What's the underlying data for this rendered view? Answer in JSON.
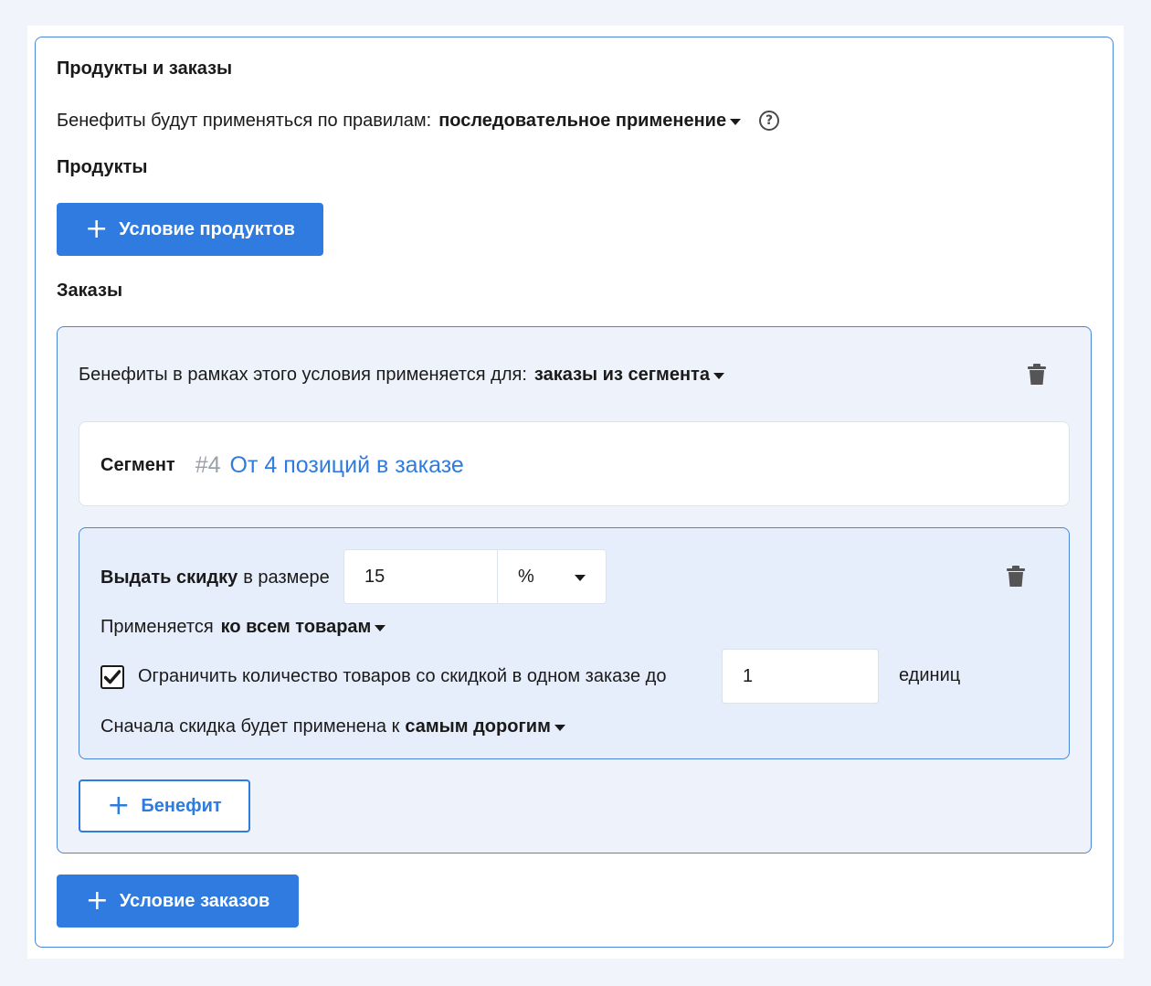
{
  "section": {
    "title": "Продукты и заказы",
    "rules_prefix": "Бенефиты будут применяться по правилам:",
    "rules_value": "последовательное применение"
  },
  "products": {
    "title": "Продукты",
    "add_button": "Условие продуктов"
  },
  "orders": {
    "title": "Заказы",
    "condition": {
      "prefix": "Бенефиты в рамках этого условия применяется для:",
      "value": "заказы из сегмента",
      "segment_label": "Сегмент",
      "segment_id": "#4",
      "segment_name": "От 4 позиций в заказе",
      "benefit": {
        "label_bold": "Выдать скидку",
        "label_rest": "в размере",
        "amount": "15",
        "unit": "%",
        "applies_prefix": "Применяется",
        "applies_value": "ко всем товарам",
        "limit_checked": true,
        "limit_text": "Ограничить количество товаров со скидкой в одном заказе до",
        "limit_value": "1",
        "limit_unit": "единиц",
        "order_prefix": "Сначала скидка будет применена к",
        "order_value": "самым дорогим"
      },
      "add_benefit_button": "Бенефит"
    },
    "add_button": "Условие заказов"
  },
  "colors": {
    "accent": "#2f7be0",
    "panel_border": "#4a86d8",
    "panel_bg": "#eef3fb"
  },
  "icons": [
    "help-icon",
    "plus-icon",
    "trash-icon",
    "chevron-down-icon",
    "checkmark-icon"
  ]
}
